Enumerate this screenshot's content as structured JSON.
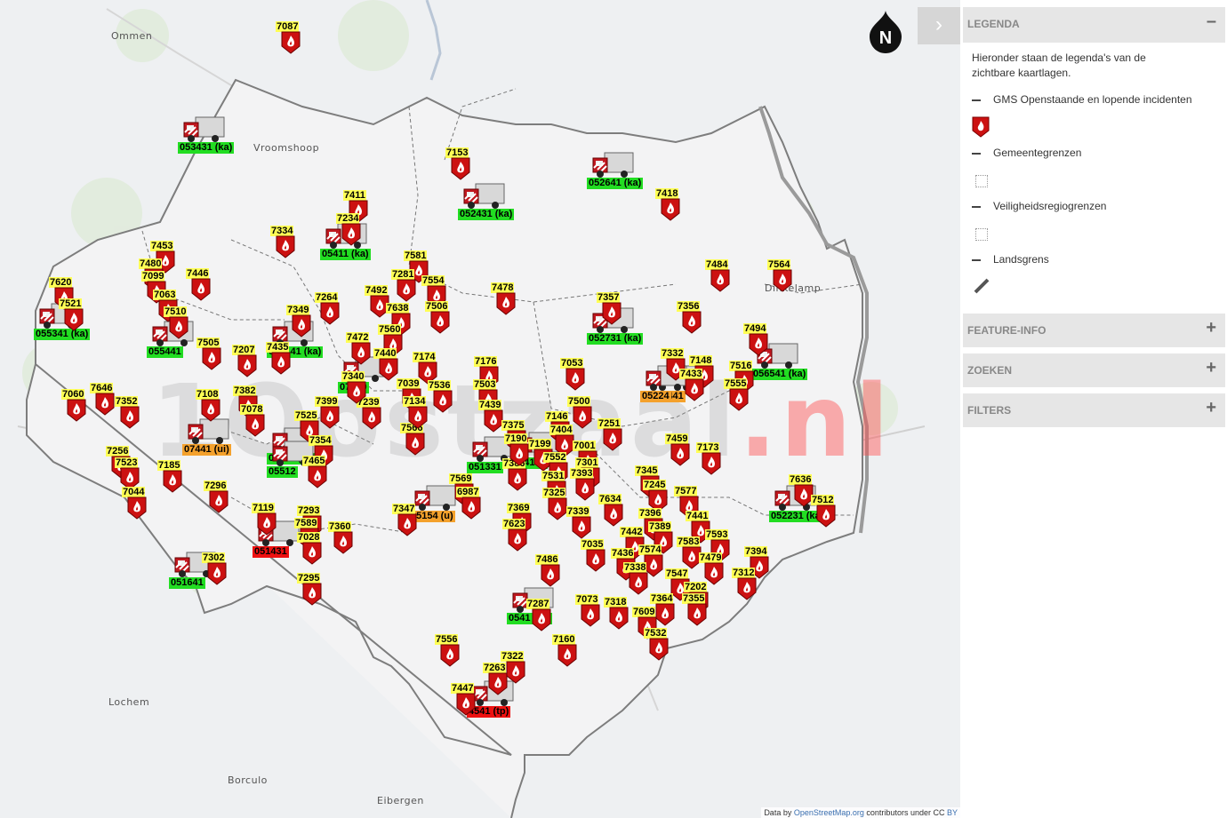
{
  "legend_panel": {
    "title": "LEGENDA",
    "intro": "Hieronder staan de legenda's van de zichtbare kaartlagen.",
    "layers": [
      "GMS Openstaande en lopende incidenten",
      "Gemeentegrenzen",
      "Veiligheidsregiogrenzen",
      "Landsgrens"
    ],
    "sections": [
      "FEATURE-INFO",
      "ZOEKEN",
      "FILTERS"
    ],
    "collapse_symbol": "–",
    "expand_symbol": "+"
  },
  "toggle_symbol": "›",
  "north_label": "N",
  "watermark": {
    "main": "1Oostzaal",
    "suffix": ".nl"
  },
  "attribution": {
    "prefix": "Data by",
    "link": "OpenStreetMap.org",
    "suffix": "contributors under CC",
    "license": "BY"
  },
  "places": [
    "Ommen",
    "Vroomshoop",
    "Lochem",
    "Borculo",
    "Eibergen",
    "Dinkelamp"
  ],
  "incidents": [
    "7087",
    "7153",
    "7411",
    "7234",
    "7418",
    "7334",
    "7453",
    "7480",
    "7099",
    "7063",
    "7510",
    "7446",
    "7620",
    "7521",
    "7581",
    "7281",
    "7554",
    "7478",
    "7484",
    "7564",
    "7492",
    "7638",
    "7506",
    "7357",
    "7349",
    "7264",
    "7560",
    "7472",
    "7440",
    "7174",
    "7356",
    "7505",
    "7207",
    "7435",
    "7494",
    "7516",
    "7332",
    "7148",
    "7433",
    "7555",
    "7060",
    "7646",
    "7352",
    "7108",
    "7382",
    "7078",
    "7399",
    "7525",
    "7239",
    "7039",
    "7536",
    "7176",
    "7503",
    "7053",
    "7439",
    "7500",
    "7146",
    "7404",
    "7251",
    "7256",
    "7523",
    "7185",
    "7296",
    "7354",
    "7465",
    "7566",
    "7375",
    "7199",
    "7001",
    "7459",
    "7173",
    "7044",
    "7569",
    "6987",
    "7386",
    "7552",
    "7301",
    "7531",
    "7393",
    "7325",
    "7345",
    "7245",
    "7577",
    "7636",
    "7512",
    "7119",
    "7293",
    "7589",
    "7028",
    "7360",
    "7347",
    "7369",
    "7339",
    "7634",
    "7396",
    "7441",
    "7623",
    "7389",
    "7593",
    "7442",
    "7302",
    "7295",
    "7486",
    "7035",
    "7436",
    "7574",
    "7583",
    "7479",
    "7394",
    "7338",
    "7547",
    "7312",
    "7202",
    "7073",
    "7318",
    "7364",
    "7355",
    "7287",
    "7609",
    "7532",
    "7556",
    "7160",
    "7263",
    "7322",
    "7447",
    "7134",
    "7340",
    "7190"
  ],
  "trucks": [
    "053431 (ka)",
    "052641 (ka)",
    "052431 (ka)",
    "055341 (ka)",
    "055441",
    "052731 (ka)",
    "051641",
    "051431",
    "055141 (ka)",
    "052231 (ka)",
    "054141",
    "051331",
    "07340",
    "056541 (ka)",
    "07441 (ui)",
    "05154 (u)",
    "05211 (ka)",
    "052441",
    "0541 (ka)",
    "05224",
    "05512",
    "05411 (ka)",
    "4541 (tp)"
  ],
  "colors": {
    "incident_red": "#cc1111",
    "label_yellow": "#ffff55",
    "truck_green": "#22dd22",
    "truck_red": "#ee1111",
    "truck_orange": "#f4a12c"
  }
}
